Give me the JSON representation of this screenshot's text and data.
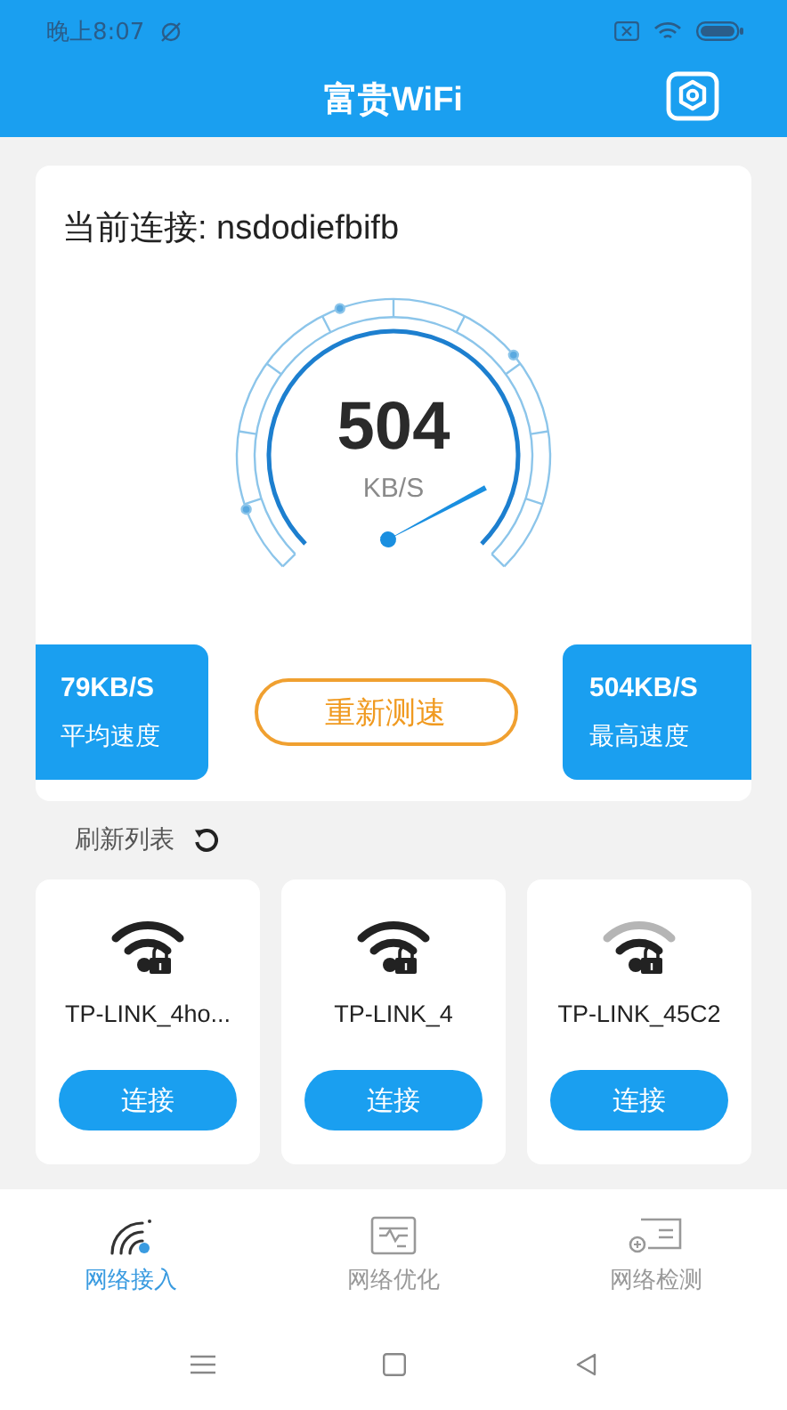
{
  "status_bar": {
    "time": "晚上8:07"
  },
  "header": {
    "title": "富贵WiFi"
  },
  "current": {
    "label": "当前连接: nsdodiefbifb"
  },
  "gauge": {
    "value": "504",
    "unit": "KB/S"
  },
  "stats": [
    {
      "value": "79KB/S",
      "label": "平均速度"
    },
    {
      "value": "504KB/S",
      "label": "最高速度"
    }
  ],
  "retest_button": "重新测速",
  "refresh": {
    "label": "刷新列表"
  },
  "networks": [
    {
      "name": "TP-LINK_4ho...",
      "kind": "strong",
      "button": "连接"
    },
    {
      "name": "TP-LINK_4",
      "kind": "strong",
      "button": "连接"
    },
    {
      "name": "TP-LINK_45C2",
      "kind": "weak",
      "button": "连接"
    }
  ],
  "tabs": [
    {
      "label": "网络接入",
      "kind": "access",
      "selected": true
    },
    {
      "label": "网络优化",
      "kind": "optimize",
      "selected": false
    },
    {
      "label": "网络检测",
      "kind": "detect",
      "selected": false
    }
  ]
}
